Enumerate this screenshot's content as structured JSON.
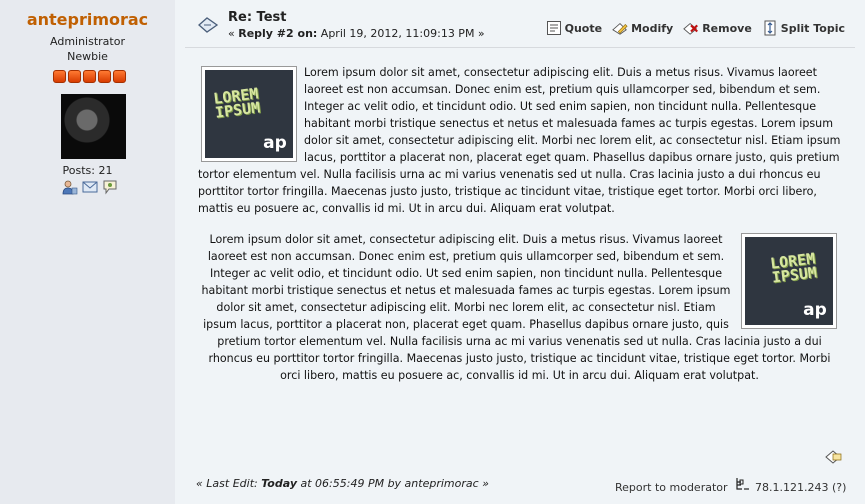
{
  "poster": {
    "name": "anteprimorac",
    "group": "Administrator",
    "rank": "Newbie",
    "stars": 5,
    "posts_label": "Posts: 21"
  },
  "post": {
    "subject": "Re: Test",
    "reply_prefix": "« ",
    "reply_label": "Reply #2 on:",
    "reply_date": " April 19, 2012, 11:09:13 PM »",
    "paragraph1": "Lorem ipsum dolor sit amet, consectetur adipiscing elit. Duis a metus risus. Vivamus laoreet laoreet est non accumsan. Donec enim est, pretium quis ullamcorper sed, bibendum et sem. Integer ac velit odio, et tincidunt odio. Ut sed enim sapien, non tincidunt nulla. Pellentesque habitant morbi tristique senectus et netus et malesuada fames ac turpis egestas. Lorem ipsum dolor sit amet, consectetur adipiscing elit. Morbi nec lorem elit, ac consectetur nisl. Etiam ipsum lacus, porttitor a placerat non, placerat eget quam. Phasellus dapibus ornare justo, quis pretium tortor elementum vel. Nulla facilisis urna ac mi varius venenatis sed ut nulla. Cras lacinia justo a dui rhoncus eu porttitor tortor fringilla. Maecenas justo justo, tristique ac tincidunt vitae, tristique eget tortor. Morbi orci libero, mattis eu posuere ac, convallis id mi. Ut in arcu dui. Aliquam erat volutpat.",
    "paragraph2": "Lorem ipsum dolor sit amet, consectetur adipiscing elit. Duis a metus risus. Vivamus laoreet laoreet est non accumsan. Donec enim est, pretium quis ullamcorper sed, bibendum et sem. Integer ac velit odio, et tincidunt odio. Ut sed enim sapien, non tincidunt nulla. Pellentesque habitant morbi tristique senectus et netus et malesuada fames ac turpis egestas. Lorem ipsum dolor sit amet, consectetur adipiscing elit. Morbi nec lorem elit, ac consectetur nisl. Etiam ipsum lacus, porttitor a placerat non, placerat eget quam. Phasellus dapibus ornare justo, quis pretium tortor elementum vel. Nulla facilisis urna ac mi varius venenatis sed ut nulla. Cras lacinia justo a dui rhoncus eu porttitor tortor fringilla. Maecenas justo justo, tristique ac tincidunt vitae, tristique eget tortor. Morbi orci libero, mattis eu posuere ac, convallis id mi. Ut in arcu dui. Aliquam erat volutpat.",
    "image_text": "LOREM IPSUM",
    "image_mark": "ap"
  },
  "buttons": {
    "quote": "Quote",
    "modify": "Modify",
    "remove": "Remove",
    "split": "Split Topic"
  },
  "footer": {
    "last_edit_prefix": "« ",
    "last_edit_label": "Last Edit: ",
    "last_edit_day": "Today",
    "last_edit_rest": " at 06:55:49 PM by anteprimorac »",
    "report": "Report to moderator",
    "ip": "78.1.121.243 (?)"
  },
  "colors": {
    "poster_name": "#c06002",
    "star": "#ff6a1a",
    "background": "#f0f4f7",
    "sidebar": "#e7eaef"
  }
}
